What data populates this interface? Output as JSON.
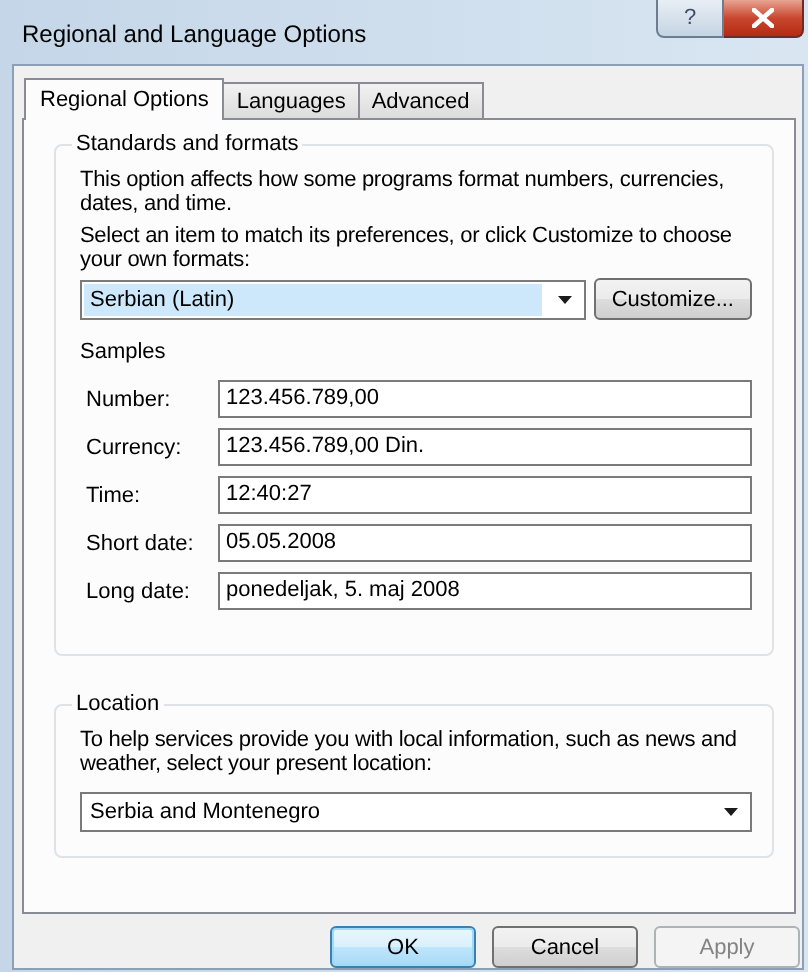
{
  "window": {
    "title": "Regional and Language Options",
    "help_button": "?"
  },
  "tabs": [
    {
      "label": "Regional Options",
      "selected": true
    },
    {
      "label": "Languages",
      "selected": false
    },
    {
      "label": "Advanced",
      "selected": false
    }
  ],
  "standards_and_formats": {
    "legend": "Standards and formats",
    "description": "This option affects how some programs format numbers, currencies, dates, and time.",
    "instruction": "Select an item to match its preferences, or click Customize to choose your own formats:",
    "format_select": {
      "value": "Serbian (Latin)",
      "focused": true
    },
    "customize_button": {
      "label": "Customize..."
    },
    "samples": {
      "heading": "Samples",
      "rows": [
        {
          "label": "Number:",
          "value": "123.456.789,00"
        },
        {
          "label": "Currency:",
          "value": "123.456.789,00 Din."
        },
        {
          "label": "Time:",
          "value": "12:40:27"
        },
        {
          "label": "Short date:",
          "value": "05.05.2008"
        },
        {
          "label": "Long date:",
          "value": "ponedeljak, 5. maj 2008"
        }
      ]
    }
  },
  "location": {
    "legend": "Location",
    "description": "To help services provide you with local information, such as news and weather, select your present location:",
    "select": {
      "value": "Serbia and Montenegro",
      "focused": false
    }
  },
  "buttons": [
    {
      "label": "OK",
      "default": true,
      "disabled": false
    },
    {
      "label": "Cancel",
      "default": false,
      "disabled": false
    },
    {
      "label": "Apply",
      "default": false,
      "disabled": true
    }
  ]
}
